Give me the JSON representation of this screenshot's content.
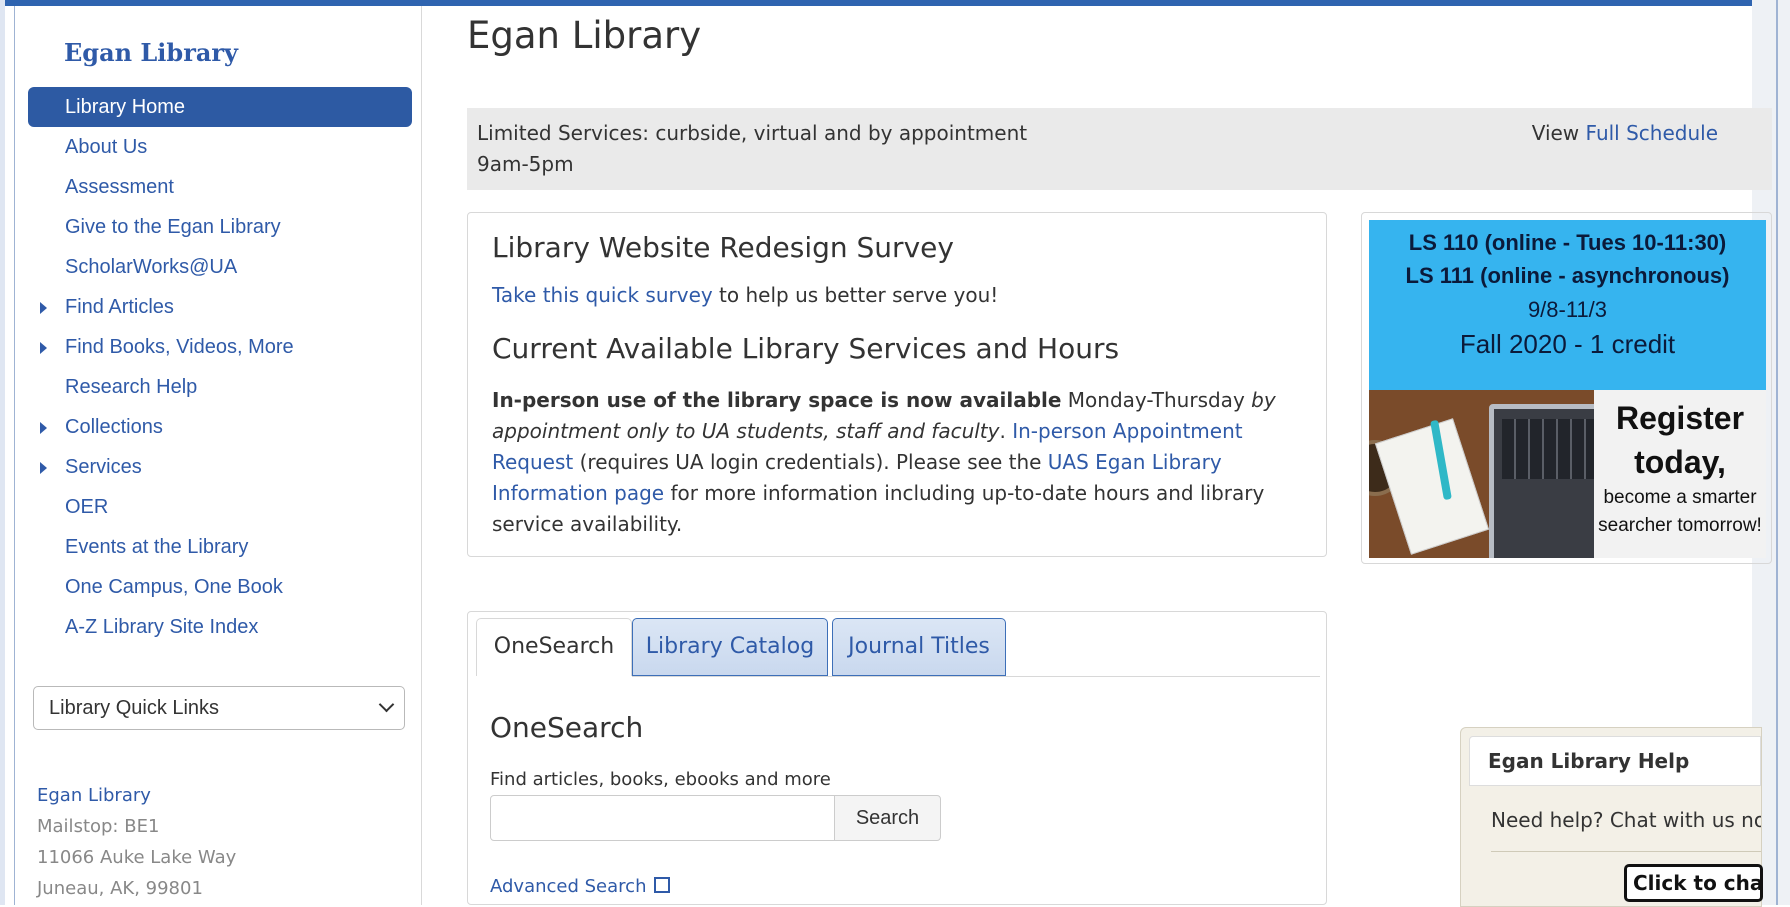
{
  "sidebar": {
    "title": "Egan Library",
    "nav": [
      {
        "label": "Library Home",
        "active": true,
        "expandable": false
      },
      {
        "label": "About Us",
        "active": false,
        "expandable": false
      },
      {
        "label": "Assessment",
        "active": false,
        "expandable": false
      },
      {
        "label": "Give to the Egan Library",
        "active": false,
        "expandable": false
      },
      {
        "label": "ScholarWorks@UA",
        "active": false,
        "expandable": false
      },
      {
        "label": "Find Articles",
        "active": false,
        "expandable": true
      },
      {
        "label": "Find Books, Videos, More",
        "active": false,
        "expandable": true
      },
      {
        "label": "Research Help",
        "active": false,
        "expandable": false
      },
      {
        "label": "Collections",
        "active": false,
        "expandable": true
      },
      {
        "label": "Services",
        "active": false,
        "expandable": true
      },
      {
        "label": "OER",
        "active": false,
        "expandable": false
      },
      {
        "label": "Events at the Library",
        "active": false,
        "expandable": false
      },
      {
        "label": "One Campus, One Book",
        "active": false,
        "expandable": false
      },
      {
        "label": "A-Z Library Site Index",
        "active": false,
        "expandable": false
      }
    ],
    "quick_links_label": "Library Quick Links",
    "address": {
      "name": "Egan Library",
      "mailstop": "Mailstop: BE1",
      "street": "11066 Auke Lake Way",
      "city": "Juneau, AK, 99801"
    }
  },
  "main": {
    "title": "Egan Library",
    "hours_banner": {
      "status": "Limited Services: curbside, virtual and by appointment",
      "hours": "9am-5pm",
      "view_prefix": "View",
      "view_link": "Full Schedule"
    },
    "survey_box": {
      "heading": "Library Website Redesign Survey",
      "survey_link": "Take this quick survey",
      "survey_text": " to help us better serve you!",
      "services_heading": "Current Available Library Services and Hours",
      "p_bold": "In-person use of the library space is now available",
      "p_text1": " Monday-Thursday ",
      "p_italic": "by appointment only to UA students, staff and faculty",
      "p_text2": ". ",
      "p_link1": "In-person Appointment Request",
      "p_text3": " (requires UA login credentials). Please see the ",
      "p_link2": "UAS Egan Library Information page",
      "p_text4": " for more information including up-to-date hours and library service availability."
    },
    "promo": {
      "line1": "LS 110 (online - Tues 10-11:30)",
      "line2": "LS 111 (online - asynchronous)",
      "line3": "9/8-11/3",
      "line4": "Fall 2020 - 1 credit",
      "cta1": "Register",
      "cta2": "today,",
      "cta3": "become a smarter searcher tomorrow!"
    },
    "search": {
      "tabs": [
        "OneSearch",
        "Library Catalog",
        "Journal Titles"
      ],
      "active_tab": "OneSearch",
      "heading": "OneSearch",
      "description": "Find articles, books, ebooks and more",
      "input_value": "",
      "button_label": "Search",
      "advanced_link": "Advanced Search"
    }
  },
  "help_widget": {
    "title": "Egan Library Help",
    "text": "Need help? Chat with us now",
    "button": "Click to chat"
  },
  "colors": {
    "brand_blue": "#2d5aa3",
    "link_blue": "#2f5aa8",
    "promo_blue": "#36b4ef",
    "banner_gray": "#eaeaea"
  },
  "icons": {
    "expand": "caret-right-icon",
    "dropdown": "chevron-down-icon",
    "external": "external-link-icon"
  }
}
